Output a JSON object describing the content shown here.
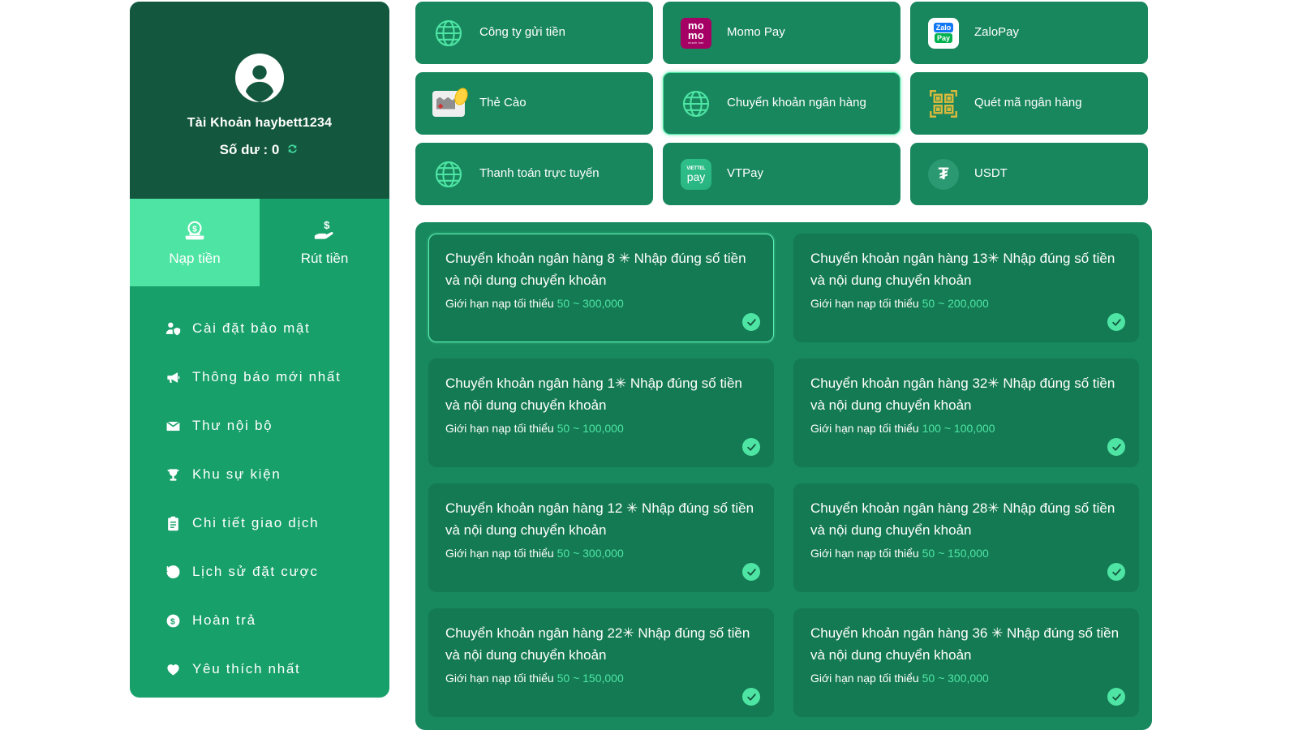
{
  "sidebar": {
    "account": {
      "avatar_icon": "user-circle-icon",
      "name_label": "Tài Khoản haybett1234",
      "balance_label": "Số dư : 0",
      "refresh_icon": "refresh-icon"
    },
    "tabs": [
      {
        "label": "Nạp tiền",
        "icon": "deposit-money-icon",
        "active": true
      },
      {
        "label": "Rút tiền",
        "icon": "withdraw-money-icon",
        "active": false
      }
    ],
    "menu": [
      {
        "label": "Cài đặt bảo mật",
        "icon": "user-shield-icon"
      },
      {
        "label": "Thông báo mới nhất",
        "icon": "megaphone-icon"
      },
      {
        "label": "Thư nội bộ",
        "icon": "envelope-icon"
      },
      {
        "label": "Khu sự kiện",
        "icon": "trophy-icon"
      },
      {
        "label": "Chi tiết giao dịch",
        "icon": "clipboard-icon"
      },
      {
        "label": "Lịch sử đặt cược",
        "icon": "history-clock-icon"
      },
      {
        "label": "Hoàn trả",
        "icon": "dollar-circle-icon"
      },
      {
        "label": "Yêu thích nhất",
        "icon": "heart-icon"
      }
    ]
  },
  "methods": [
    {
      "label": "Công ty gửi tiền",
      "icon": "globe-icon",
      "selected": false
    },
    {
      "label": "Momo Pay",
      "icon": "momo-logo",
      "selected": false
    },
    {
      "label": "ZaloPay",
      "icon": "zalopay-logo",
      "selected": false
    },
    {
      "label": "Thẻ Cào",
      "icon": "scratch-card-icon",
      "selected": false
    },
    {
      "label": "Chuyển khoản ngân hàng",
      "icon": "globe-icon",
      "selected": true
    },
    {
      "label": "Quét mã ngân hàng",
      "icon": "qr-code-icon",
      "selected": false
    },
    {
      "label": "Thanh toán trực tuyến",
      "icon": "globe-icon",
      "selected": false
    },
    {
      "label": "VTPay",
      "icon": "vtpay-logo",
      "selected": false
    },
    {
      "label": "USDT",
      "icon": "usdt-logo",
      "selected": false
    }
  ],
  "bank_options": [
    {
      "title": "Chuyển khoản ngân hàng 8 ✳ Nhập đúng số tiền và nội dung chuyển khoản",
      "limit_label": "Giới hạn nạp tối thiểu",
      "range": "50 ~ 300,000",
      "selected": true,
      "check_icon": "check-circle-icon"
    },
    {
      "title": "Chuyển khoản ngân hàng 13✳ Nhập đúng số tiền và nội dung chuyển khoản",
      "limit_label": "Giới hạn nạp tối thiểu",
      "range": "50 ~ 200,000",
      "selected": false,
      "check_icon": "check-circle-icon"
    },
    {
      "title": "Chuyển khoản ngân hàng 1✳ Nhập đúng số tiền và nội dung chuyển khoản",
      "limit_label": "Giới hạn nạp tối thiểu",
      "range": "50 ~ 100,000",
      "selected": false,
      "check_icon": "check-circle-icon"
    },
    {
      "title": "Chuyển khoản ngân hàng 32✳ Nhập đúng số tiền và nội dung chuyển khoản",
      "limit_label": "Giới hạn nạp tối thiểu",
      "range": "100 ~ 100,000",
      "selected": false,
      "check_icon": "check-circle-icon"
    },
    {
      "title": "Chuyển khoản ngân hàng 12 ✳ Nhập đúng số tiền và nội dung chuyển khoản",
      "limit_label": "Giới hạn nạp tối thiểu",
      "range": "50 ~ 300,000",
      "selected": false,
      "check_icon": "check-circle-icon"
    },
    {
      "title": "Chuyển khoản ngân hàng 28✳ Nhập đúng số tiền và nội dung chuyển khoản",
      "limit_label": "Giới hạn nạp tối thiểu",
      "range": "50 ~ 150,000",
      "selected": false,
      "check_icon": "check-circle-icon"
    },
    {
      "title": "Chuyển khoản ngân hàng 22✳ Nhập đúng số tiền và nội dung chuyển khoản",
      "limit_label": "Giới hạn nạp tối thiểu",
      "range": "50 ~ 150,000",
      "selected": false,
      "check_icon": "check-circle-icon"
    },
    {
      "title": "Chuyển khoản ngân hàng 36 ✳ Nhập đúng số tiền và nội dung chuyển khoản",
      "limit_label": "Giới hạn nạp tối thiểu",
      "range": "50 ~ 300,000",
      "selected": false,
      "check_icon": "check-circle-icon"
    }
  ],
  "logos": {
    "momo_line1": "mo",
    "momo_line2": "mo",
    "momo_sub": "nhanh hơn",
    "zalo_line1": "Zalo",
    "zalo_line2": "Pay",
    "vtpay_line1": "VIETTEL",
    "vtpay_line2": "pay",
    "usdt_mark": "₮"
  },
  "colors": {
    "brand_green": "#17A06A",
    "dark_green": "#14573F",
    "accent_mint": "#4EE5A4",
    "card_green": "#147A53",
    "panel_green": "#18885F",
    "momo_pink": "#A50064",
    "qr_gold": "#D9B93C"
  }
}
